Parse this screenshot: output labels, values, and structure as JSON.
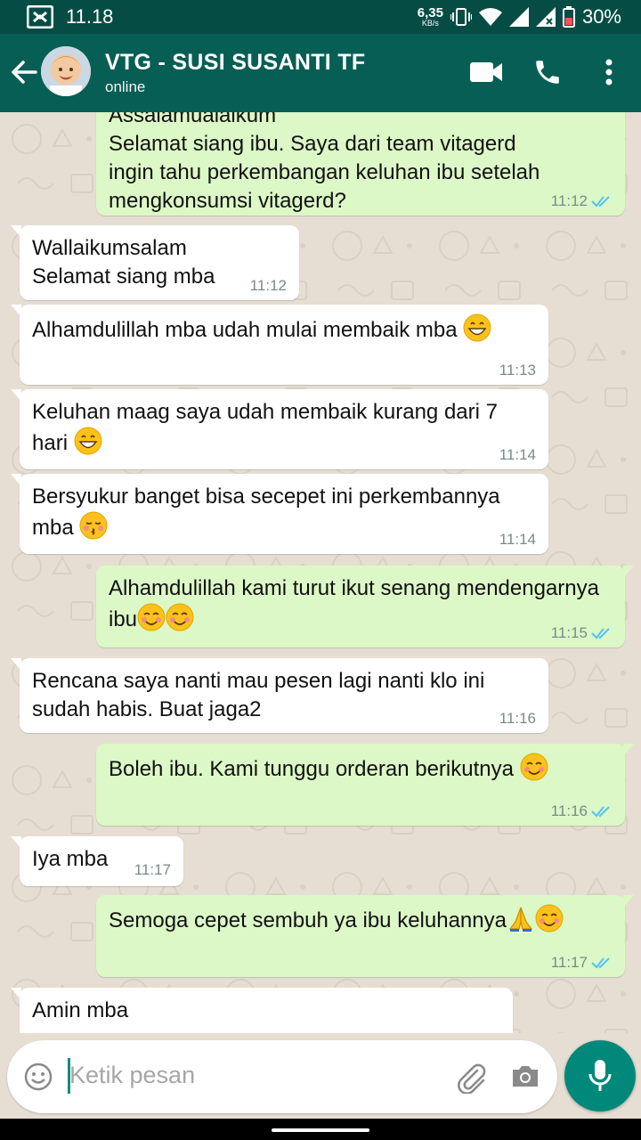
{
  "status_bar": {
    "time": "11.18",
    "speed_value": "6,35",
    "speed_unit": "KB/s",
    "battery": "30%"
  },
  "header": {
    "contact_name": "VTG - SUSI SUSANTI TF",
    "status": "online"
  },
  "messages": [
    {
      "dir": "out",
      "partial_top": "Assalamualaikum",
      "text": "Selamat siang ibu. Saya dari team vitagerd\ningin tahu perkembangan keluhan ibu setelah\nmengkonsumsi vitagerd?",
      "time": "11:12",
      "read": true
    },
    {
      "dir": "in",
      "text": "Wallaikumsalam\nSelamat siang mba",
      "time": "11:12"
    },
    {
      "dir": "in",
      "text": "Alhamdulillah mba udah mulai membaik mba",
      "emoji": [
        "grin"
      ],
      "time": "11:13"
    },
    {
      "dir": "in",
      "text": "Keluhan maag saya udah membaik kurang dari 7\nhari",
      "emoji": [
        "grin"
      ],
      "time": "11:14"
    },
    {
      "dir": "in",
      "text": "Bersyukur banget bisa secepet ini perkembannya\nmba",
      "emoji": [
        "kiss"
      ],
      "time": "11:14"
    },
    {
      "dir": "out",
      "text": "Alhamdulillah kami turut ikut senang mendengarnya\nibu",
      "emoji": [
        "smile",
        "smile"
      ],
      "time": "11:15",
      "read": true
    },
    {
      "dir": "in",
      "text": "Rencana saya nanti mau pesen lagi nanti klo ini\nsudah habis. Buat jaga2",
      "time": "11:16"
    },
    {
      "dir": "out",
      "text": "Boleh ibu. Kami tunggu orderan berikutnya",
      "emoji": [
        "smile"
      ],
      "time": "11:16",
      "read": true
    },
    {
      "dir": "in",
      "text": "Iya mba",
      "time": "11:17"
    },
    {
      "dir": "out",
      "text": "Semoga cepet sembuh ya ibu keluhannya",
      "emoji": [
        "pray",
        "smile"
      ],
      "time": "11:17",
      "read": true
    },
    {
      "dir": "in",
      "text": "Amin mba",
      "time": ""
    }
  ],
  "input": {
    "placeholder": "Ketik pesan"
  },
  "icons": {
    "back": "arrow-left-icon",
    "video": "video-call-icon",
    "call": "phone-icon",
    "menu": "more-vert-icon",
    "emoji": "emoji-icon",
    "attach": "paperclip-icon",
    "camera": "camera-icon",
    "mic": "mic-icon"
  },
  "colors": {
    "header": "#075e54",
    "status_bar": "#054d44",
    "outgoing_bubble": "#dcf8c6",
    "incoming_bubble": "#ffffff",
    "chat_bg": "#e6ded3",
    "mic_button": "#00897b",
    "read_ticks": "#4fc3f7"
  }
}
